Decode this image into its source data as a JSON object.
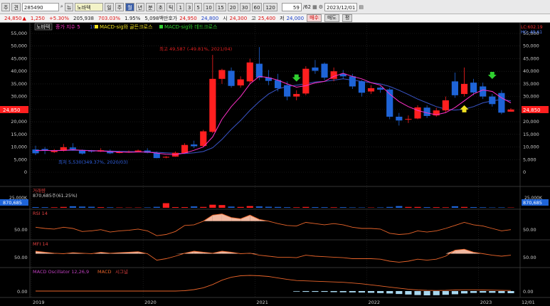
{
  "toolbar": {
    "mode": "주",
    "market_flag": "견",
    "code": "285490",
    "search_label": "뉴",
    "stock_name": "노바텍",
    "periods": [
      "일",
      "주",
      "월",
      "년",
      "분",
      "초",
      "틱"
    ],
    "active_period": "월",
    "intervals": [
      "1",
      "3",
      "5",
      "10",
      "15",
      "20",
      "30",
      "60",
      "120"
    ],
    "count": "59",
    "total": "/62",
    "date": "2023/12/01"
  },
  "quote": {
    "price": "24,850",
    "change": "1,250",
    "change_pct": "+5.30%",
    "volume": "205,938",
    "turnover_pct": "703.03%",
    "ratio": "1.95%",
    "amount": "5,098백만",
    "ask_label": "호가",
    "ask": "24,950",
    "bid": "24,800",
    "open_label": "시",
    "open": "24,300",
    "high_label": "고",
    "high": "25,400",
    "low_label": "저",
    "low": "24,000",
    "buy_label": "매수",
    "sell_label": "매도",
    "eval_label": "평"
  },
  "legend": {
    "name": "노바텍",
    "ma": "종가 지수 5",
    "ma_num": "10",
    "golden": "MACD-sig와 골든크로스",
    "dead": "MACD-sig와 데드크로스",
    "lc": "LC:602.19",
    "hc": "HC:-49.61"
  },
  "annotations": {
    "high_note": "최고 49,587 (-49.81%, 2021/04)",
    "low_note": "최저 5,530(349.37%, 2020/03)"
  },
  "labels": {
    "volume": "거래량",
    "volume_tick": "25,000K",
    "volume_value": "870,685",
    "volume_pct": "870,685주(61.25%)",
    "rsi": "RSI 14",
    "mfi": "MFI 14",
    "macd": "MACD Oscillator 12,26,9",
    "macd2": "MACD",
    "macd3": "시그널",
    "fifty": "50.00",
    "zero": "0.00",
    "price_tag": "24,850"
  },
  "colors": {
    "up": "#ff1f1f",
    "down": "#1e64d8",
    "ma5": "#ff30c8",
    "ma10": "#3a55c8",
    "osc": "#a8d8f0",
    "accent_red": "#e01010"
  },
  "chart_data": [
    {
      "type": "candlestick",
      "title": "노바텍",
      "x": [
        "2019/01",
        "2019/02",
        "2019/03",
        "2019/04",
        "2019/05",
        "2019/06",
        "2019/07",
        "2019/08",
        "2019/09",
        "2019/10",
        "2019/11",
        "2019/12",
        "2020/01",
        "2020/02",
        "2020/03",
        "2020/04",
        "2020/05",
        "2020/06",
        "2020/07",
        "2020/08",
        "2020/09",
        "2020/10",
        "2020/11",
        "2020/12",
        "2021/01",
        "2021/02",
        "2021/03",
        "2021/04",
        "2021/05",
        "2021/06",
        "2021/07",
        "2021/08",
        "2021/09",
        "2021/10",
        "2021/11",
        "2021/12",
        "2022/01",
        "2022/02",
        "2022/03",
        "2022/04",
        "2022/05",
        "2022/06",
        "2022/07",
        "2022/08",
        "2022/09",
        "2022/10",
        "2022/11",
        "2022/12",
        "2023/01",
        "2023/02",
        "2023/03",
        "2023/04",
        "2023/05",
        "2023/06",
        "2023/07",
        "2023/08",
        "2023/09",
        "2023/10",
        "2023/11",
        "2023/12"
      ],
      "open": [
        9000,
        9200,
        8000,
        8500,
        9800,
        8800,
        8500,
        8200,
        8300,
        7800,
        8000,
        8200,
        8600,
        7600,
        5800,
        6200,
        7600,
        11000,
        10400,
        16000,
        37000,
        40200,
        34400,
        36000,
        43000,
        37500,
        36500,
        34500,
        30000,
        31200,
        41500,
        43000,
        37000,
        39000,
        38000,
        36000,
        32000,
        33500,
        32800,
        22000,
        21000,
        21300,
        25600,
        22500,
        24500,
        36000,
        31000,
        35500,
        34000,
        30000,
        31400,
        24000
      ],
      "close": [
        7500,
        8500,
        8600,
        9900,
        9100,
        7400,
        8200,
        8700,
        7500,
        7900,
        8100,
        8600,
        7700,
        5600,
        6100,
        7700,
        10800,
        10300,
        16200,
        37000,
        40500,
        34200,
        36800,
        43500,
        37500,
        36200,
        33300,
        30000,
        31000,
        41000,
        40200,
        37500,
        40000,
        38000,
        34000,
        31500,
        33300,
        32700,
        22000,
        20500,
        21100,
        25700,
        22300,
        24500,
        28500,
        30500,
        35000,
        31600,
        30000,
        27000,
        23600,
        24850
      ],
      "high": [
        10500,
        10000,
        9200,
        11200,
        11500,
        9000,
        8800,
        9500,
        9000,
        8500,
        8600,
        9000,
        9500,
        8200,
        6400,
        8200,
        11500,
        12500,
        16800,
        46500,
        41000,
        41500,
        38000,
        45000,
        49587,
        40500,
        39000,
        36000,
        32500,
        42000,
        44500,
        43500,
        41500,
        40500,
        39000,
        36500,
        34500,
        34000,
        33500,
        23500,
        22500,
        26500,
        26500,
        25500,
        30000,
        39500,
        41500,
        37000,
        35500,
        31000,
        32500,
        25400
      ],
      "low": [
        6800,
        7200,
        7600,
        8200,
        8500,
        7000,
        7800,
        8000,
        7200,
        7500,
        7700,
        7900,
        7500,
        5530,
        5530,
        6100,
        7500,
        9600,
        10000,
        15500,
        35000,
        33500,
        33500,
        35000,
        36500,
        34500,
        32000,
        28500,
        28500,
        30500,
        39000,
        36500,
        36000,
        37000,
        33000,
        30000,
        31000,
        31500,
        21000,
        18500,
        19500,
        21000,
        21500,
        22000,
        23500,
        29500,
        30000,
        30500,
        29000,
        26000,
        23000,
        24000
      ],
      "ma5": [
        8600,
        8700,
        8500,
        8700,
        8900,
        8700,
        8500,
        8400,
        8200,
        8000,
        7900,
        8000,
        8000,
        7600,
        7100,
        7000,
        7600,
        8700,
        10000,
        14000,
        21000,
        26000,
        30000,
        35000,
        38000,
        37500,
        36500,
        35000,
        33700,
        34300,
        35400,
        36000,
        38000,
        39200,
        38000,
        37000,
        35500,
        34500,
        31000,
        28000,
        26000,
        24500,
        23500,
        22800,
        23600,
        25600,
        28300,
        31000,
        32600,
        32000,
        29500,
        27500
      ],
      "ma10": [
        8500,
        8600,
        8600,
        8700,
        8700,
        8700,
        8600,
        8500,
        8400,
        8300,
        8200,
        8100,
        8000,
        7900,
        7700,
        7500,
        7400,
        7700,
        8200,
        9700,
        13000,
        17000,
        20500,
        24500,
        28000,
        31000,
        33000,
        34000,
        34500,
        35000,
        35800,
        36000,
        36500,
        37000,
        36500,
        36000,
        35500,
        35000,
        34000,
        32500,
        30800,
        29000,
        27500,
        26000,
        25000,
        24600,
        25000,
        26000,
        27500,
        28300,
        28800,
        28300
      ]
    },
    {
      "type": "bar",
      "title": "거래량",
      "values": [
        2000,
        1800,
        1500,
        2500,
        4500,
        3500,
        3000,
        1800,
        1500,
        1000,
        800,
        900,
        1200,
        2800,
        13500,
        2000,
        2000,
        4000,
        2500,
        9000,
        8000,
        3500,
        2500,
        5000,
        4000,
        3000,
        2500,
        1800,
        1500,
        2500,
        2000,
        1800,
        1500,
        1800,
        1200,
        1000,
        900,
        1200,
        2500,
        5000,
        2500,
        2500,
        2000,
        1800,
        1500,
        4500,
        2500,
        2000,
        1500,
        1000,
        1200,
        870.685
      ],
      "ylim": [
        0,
        25000
      ],
      "ylabel": "K"
    },
    {
      "type": "line",
      "title": "RSI 14",
      "values": [
        52,
        50,
        49,
        52,
        50,
        45,
        46,
        48,
        44,
        46,
        47,
        49,
        46,
        38,
        40,
        45,
        55,
        56,
        62,
        72,
        74,
        68,
        66,
        72,
        65,
        62,
        58,
        55,
        54,
        60,
        58,
        56,
        58,
        56,
        52,
        50,
        50,
        49,
        42,
        40,
        41,
        46,
        44,
        46,
        50,
        55,
        60,
        56,
        54,
        50,
        46,
        48
      ],
      "ylim": [
        0,
        100
      ]
    },
    {
      "type": "line",
      "title": "MFI 14",
      "values": [
        60,
        58,
        56,
        55,
        57,
        56,
        55,
        58,
        56,
        57,
        58,
        59,
        55,
        42,
        45,
        50,
        56,
        60,
        58,
        56,
        60,
        58,
        55,
        56,
        52,
        50,
        48,
        48,
        47,
        52,
        50,
        49,
        48,
        47,
        45,
        45,
        45,
        44,
        40,
        38,
        40,
        44,
        42,
        44,
        50,
        62,
        64,
        58,
        55,
        52,
        50,
        52
      ],
      "ylim": [
        0,
        100
      ]
    },
    {
      "type": "area",
      "title": "MACD Oscillator 12,26,9",
      "osc": [
        0,
        0,
        0,
        0,
        0,
        0,
        0,
        0,
        0,
        0,
        0,
        0,
        0,
        0,
        0,
        0,
        0,
        0,
        0,
        0,
        0,
        0,
        0,
        0,
        0,
        0,
        0,
        0,
        -200,
        -300,
        -300,
        -300,
        -400,
        -450,
        -500,
        -550,
        -650,
        -750,
        -900,
        -1100,
        -1300,
        -1500,
        -1600,
        -1550,
        -1400,
        -1200,
        -900,
        -700,
        -600,
        -650,
        -750,
        -800
      ],
      "macd": [
        0,
        0,
        0,
        0,
        0,
        0,
        0,
        0,
        0,
        0,
        0,
        0,
        0,
        0,
        0,
        0,
        100,
        400,
        900,
        1800,
        3000,
        3800,
        4200,
        4300,
        4200,
        4000,
        3600,
        3200,
        2900,
        2800,
        2700,
        2600,
        2500,
        2400,
        2200,
        2000,
        1700,
        1400,
        1100,
        800,
        500,
        300,
        200,
        150,
        200,
        300,
        350,
        350,
        300,
        250,
        200,
        150
      ],
      "zero_label": "0.00"
    }
  ]
}
